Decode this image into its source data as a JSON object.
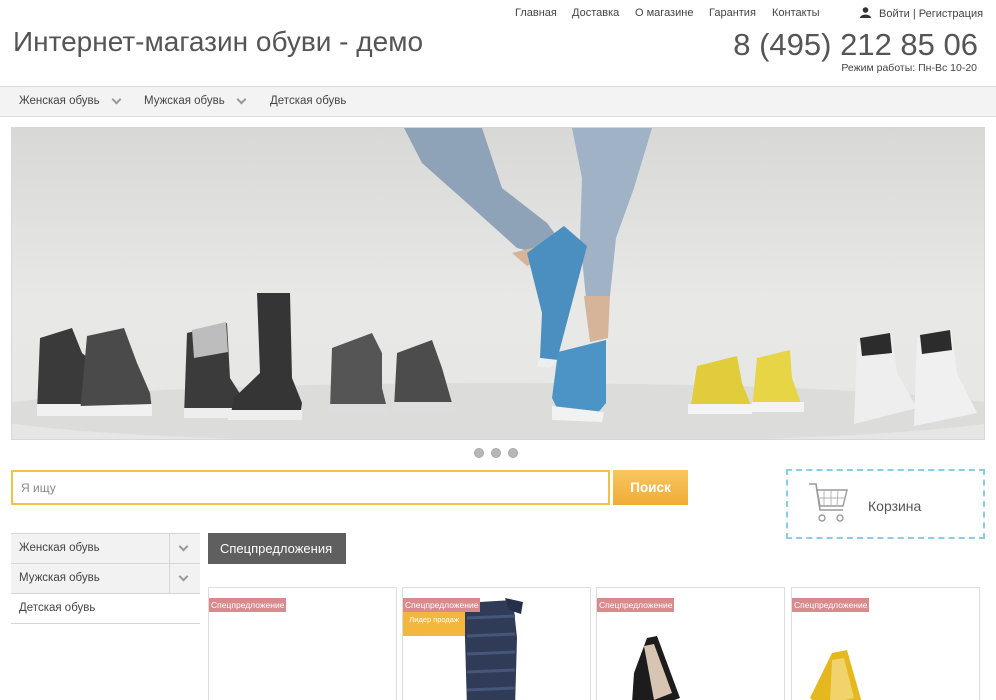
{
  "topnav": {
    "items": [
      "Главная",
      "Доставка",
      "О магазине",
      "Гарантия",
      "Контакты"
    ],
    "auth": "Войти | Регистрация"
  },
  "header": {
    "shop_name": "Интернет-магазин обуви - демо",
    "phone": "8 (495) 212 85 06",
    "hours": "Режим работы: Пн-Вс 10-20"
  },
  "catbar": {
    "items": [
      "Женская обувь",
      "Мужская обувь",
      "Детская обувь"
    ]
  },
  "slider": {
    "slides_count": 3,
    "active_slide": 1
  },
  "search": {
    "placeholder": "Я ищу",
    "button": "Поиск"
  },
  "cart": {
    "label": "Корзина"
  },
  "sidebar": {
    "items": [
      "Женская обувь",
      "Мужская обувь",
      "Детская обувь"
    ]
  },
  "section": {
    "title": "Спецпредложения"
  },
  "products": [
    {
      "badge": "Спецпредложение",
      "badge2": ""
    },
    {
      "badge": "Спецпредложение",
      "badge2": "Лидер продаж"
    },
    {
      "badge": "Спецпредложение",
      "badge2": ""
    },
    {
      "badge": "Спецпредложение",
      "badge2": ""
    }
  ],
  "colors": {
    "search_border": "#f0c347",
    "search_button": "#efac36",
    "cart_border": "#88cfe6",
    "badge": "#d98a8d",
    "section_button": "#5f5f5f"
  }
}
